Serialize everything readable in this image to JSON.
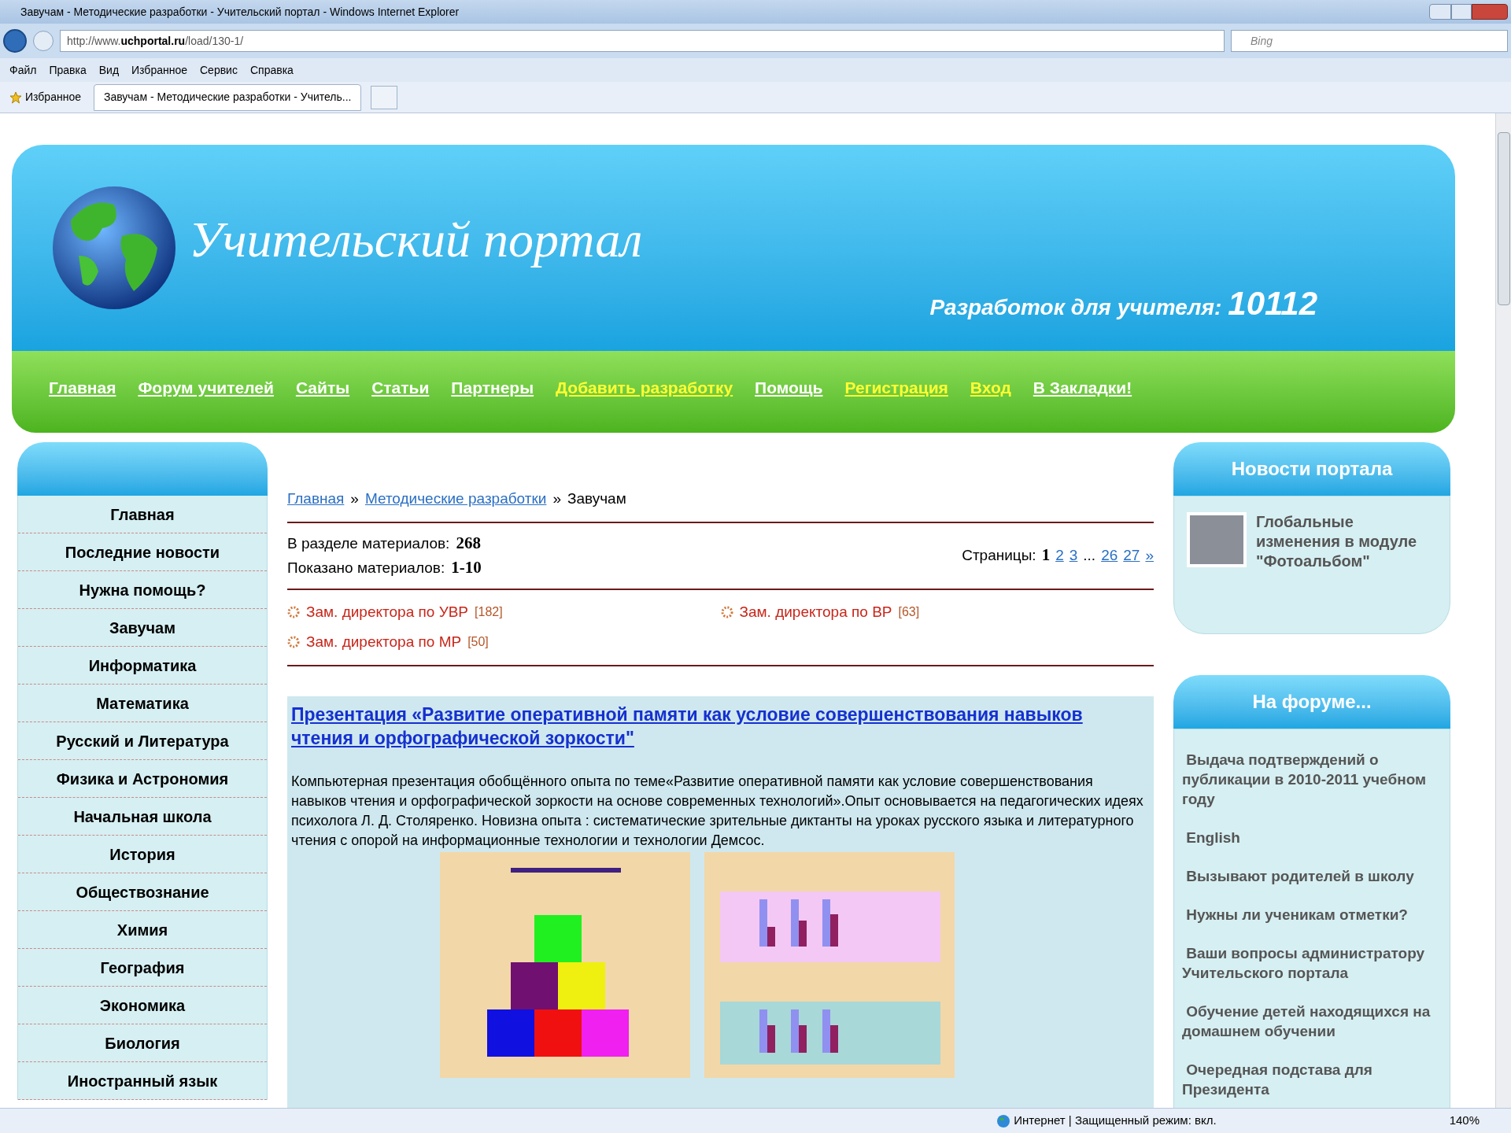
{
  "browser": {
    "title": "Завучам - Методические разработки - Учительский портал - Windows Internet Explorer",
    "address_prefix": "http://www.",
    "address_host": "uchportal.ru",
    "address_path": "/load/130-1/",
    "search_placeholder": "Bing",
    "menu": [
      "Файл",
      "Правка",
      "Вид",
      "Избранное",
      "Сервис",
      "Справка"
    ],
    "favorites": "Избранное",
    "tabs": [
      {
        "label": "Завучам - Методические разработки - Учитель...",
        "selected": true
      }
    ]
  },
  "header": {
    "logo_text": "Учительский портал",
    "counter_label": "Разработок для учителя:",
    "counter_value": "10112"
  },
  "nav": [
    {
      "label": "Главная",
      "highlight": false
    },
    {
      "label": "Форум учителей",
      "highlight": false
    },
    {
      "label": "Сайты",
      "highlight": false
    },
    {
      "label": "Статьи",
      "highlight": false
    },
    {
      "label": "Партнеры",
      "highlight": false
    },
    {
      "label": "Добавить разработку",
      "highlight": true
    },
    {
      "label": "Помощь",
      "highlight": false
    },
    {
      "label": "Регистрация",
      "highlight": true
    },
    {
      "label": "Вход",
      "highlight": true
    },
    {
      "label": "В Закладки!",
      "highlight": false
    }
  ],
  "sidebar": {
    "items": [
      "Главная",
      "Последние новости",
      "Нужна помощь?",
      "Завучам",
      "Информатика",
      "Математика",
      "Русский и Литература",
      "Физика и Астрономия",
      "Начальная школа",
      "История",
      "Обществознание",
      "Химия",
      "География",
      "Экономика",
      "Биология",
      "Иностранный язык"
    ]
  },
  "breadcrumb": {
    "separator": "»",
    "items": [
      {
        "label": "Главная",
        "kind": "link"
      },
      {
        "label": "Методические разработки",
        "kind": "link"
      },
      {
        "label": "Завучам",
        "kind": "current"
      }
    ]
  },
  "stats": [
    {
      "label": "В разделе материалов:",
      "value": "268"
    },
    {
      "label": "Показано материалов:",
      "value": "1-10"
    }
  ],
  "pager": {
    "label": "Страницы:",
    "pages": [
      {
        "label": "1",
        "kind": "page",
        "selected": true
      },
      {
        "label": "2",
        "kind": "page",
        "selected": false
      },
      {
        "label": "3",
        "kind": "page",
        "selected": false
      },
      {
        "label": "...",
        "kind": "gap"
      },
      {
        "label": "26",
        "kind": "page",
        "selected": false
      },
      {
        "label": "27",
        "kind": "page",
        "selected": false
      },
      {
        "label": "»",
        "kind": "page",
        "selected": false
      }
    ]
  },
  "categories": [
    {
      "label": "Зам. директора по УВР",
      "count": "[182]"
    },
    {
      "label": "Зам. директора по ВР",
      "count": "[63]"
    },
    {
      "label": "Зам. директора по МР",
      "count": "[50]"
    }
  ],
  "article": {
    "title": "Презентация «Развитие оперативной памяти как условие совершенствования навыков чтения и орфографической зоркости\"",
    "text": "Компьютерная презентация обобщённого опыта по теме«Развитие оперативной памяти как условие совершенствования навыков чтения и орфографической зоркости на основе современных технологий».Опыт основывается на педагогических идеях психолога Л. Д. Столяренко. Новизна опыта : систематические зрительные диктанты на уроках русского языка и литературного чтения с опорой на информационные технологии и технологии Демсос."
  },
  "news": {
    "title": "Новости портала",
    "items": [
      "Глобальные изменения в модуле \"Фотоальбом\""
    ]
  },
  "forum": {
    "title": "На форуме...",
    "items": [
      "Выдача подтверждений о публикации в 2010-2011 учебном году",
      "English",
      "Вызывают родителей в школу",
      "Нужны ли ученикам отметки?",
      "Ваши вопросы администратору Учительского портала",
      "Обучение детей находящихся на домашнем обучении",
      "Очередная подстава для Президента"
    ]
  },
  "status_bar": {
    "zone": "Интернет | Защищенный режим: вкл.",
    "zoom": "140%"
  }
}
